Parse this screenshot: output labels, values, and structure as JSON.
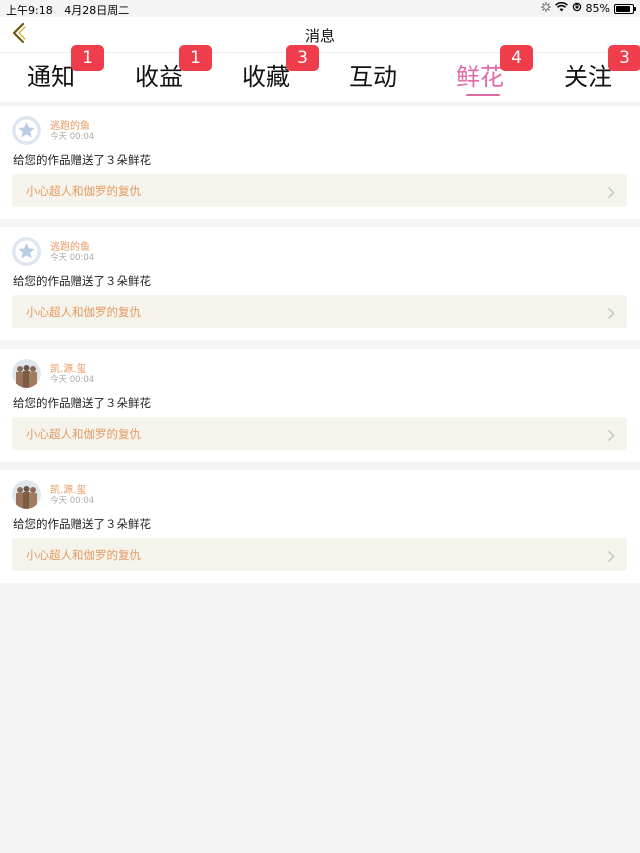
{
  "status_bar": {
    "time": "上午9:18",
    "date": "4月28日周二",
    "battery": "85%",
    "battery_level": 0.85
  },
  "nav": {
    "title": "消息"
  },
  "tabs": [
    {
      "label": "通知",
      "badge": "1"
    },
    {
      "label": "收益",
      "badge": "1"
    },
    {
      "label": "收藏",
      "badge": "3"
    },
    {
      "label": "互动",
      "badge": ""
    },
    {
      "label": "鲜花",
      "badge": "4"
    },
    {
      "label": "关注",
      "badge": "3"
    }
  ],
  "active_tab": "鲜花",
  "colors": {
    "accent": "#e06aa5",
    "badge": "#ef3d4c",
    "username": "#e59a62",
    "work_bg": "#f5f4ec"
  },
  "messages": [
    {
      "username": "逃跑的鱼",
      "time": "今天 00:04",
      "text": "给您的作品赠送了３朵鲜花",
      "work": "小心超人和伽罗的复仇",
      "avatar": "default-star-avatar"
    },
    {
      "username": "逃跑的鱼",
      "time": "今天 00:04",
      "text": "给您的作品赠送了３朵鲜花",
      "work": "小心超人和伽罗的复仇",
      "avatar": "default-star-avatar"
    },
    {
      "username": "凯.源.玺",
      "time": "今天 00:04",
      "text": "给您的作品赠送了３朵鲜花",
      "work": "小心超人和伽罗的复仇",
      "avatar": "photo-avatar"
    },
    {
      "username": "凯.源.玺",
      "time": "今天 00:04",
      "text": "给您的作品赠送了３朵鲜花",
      "work": "小心超人和伽罗的复仇",
      "avatar": "photo-avatar"
    }
  ]
}
